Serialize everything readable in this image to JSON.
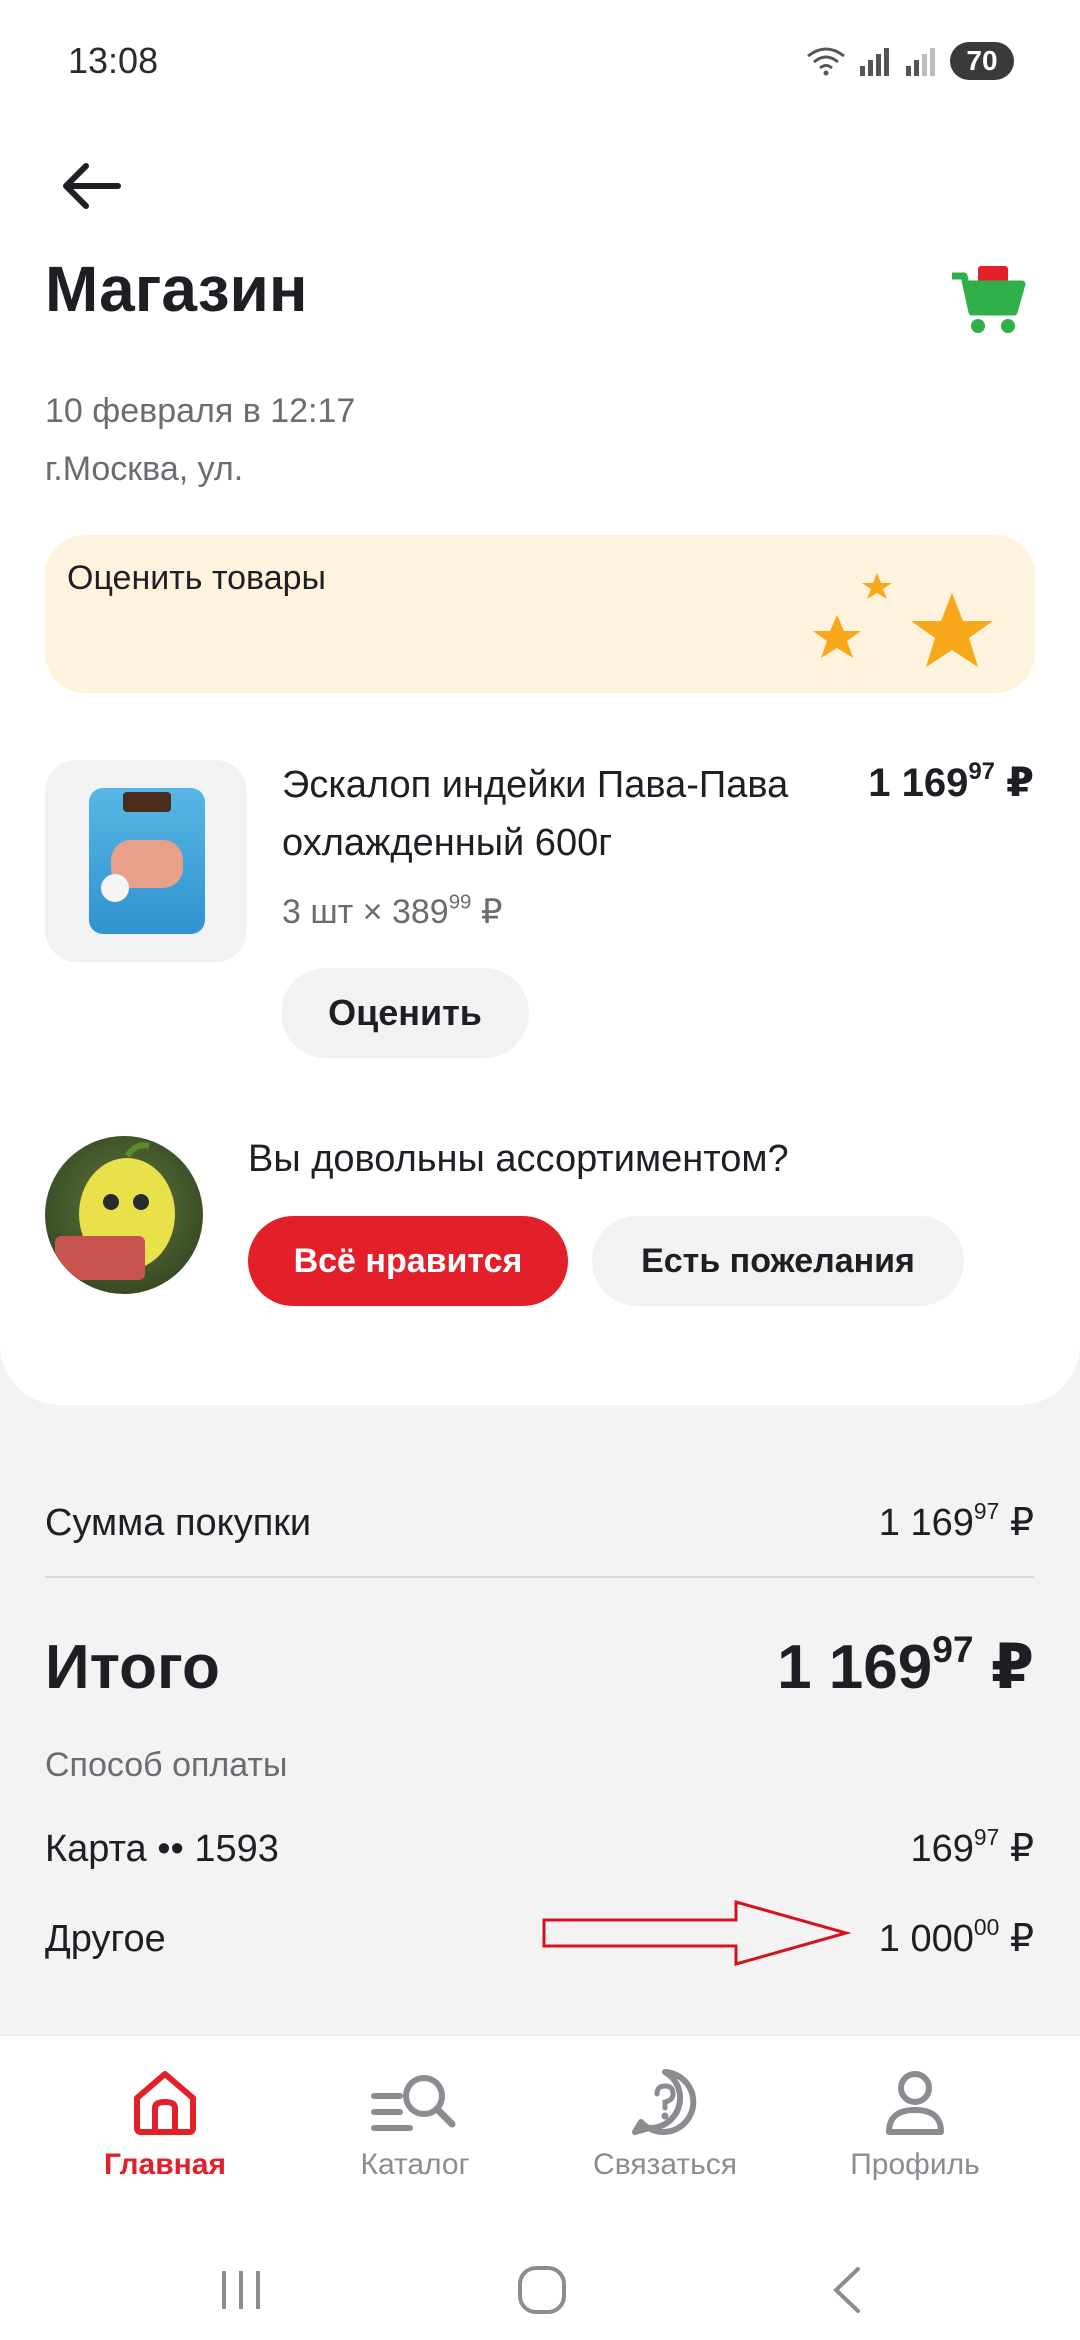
{
  "status_bar": {
    "time": "13:08",
    "battery": "70"
  },
  "header": {
    "title": "Магазин"
  },
  "order": {
    "date": "10 февраля в 12:17",
    "address": "г.Москва, ул."
  },
  "rate_banner": {
    "label": "Оценить товары"
  },
  "product": {
    "name": "Эскалоп индейки Пава-Пава охлажденный 600г",
    "price_main": "1 169",
    "price_kop": "97",
    "qty": "3 шт",
    "unit_price_main": "389",
    "unit_price_kop": "99",
    "currency": "₽",
    "rate_button": "Оценить"
  },
  "survey": {
    "question": "Вы довольны ассортиментом?",
    "like_button": "Всё нравится",
    "wish_button": "Есть пожелания"
  },
  "summary": {
    "sum_label": "Сумма покупки",
    "sum_main": "1 169",
    "sum_kop": "97",
    "total_label": "Итого",
    "total_main": "1 169",
    "total_kop": "97",
    "payment_label": "Способ оплаты",
    "card_label": "Карта •• 1593",
    "card_main": "169",
    "card_kop": "97",
    "other_label": "Другое",
    "other_main": "1 000",
    "other_kop": "00"
  },
  "nav": [
    {
      "label": "Главная",
      "icon": "home-icon",
      "active": true
    },
    {
      "label": "Каталог",
      "icon": "catalog-search-icon",
      "active": false
    },
    {
      "label": "Связаться",
      "icon": "help-chat-icon",
      "active": false
    },
    {
      "label": "Профиль",
      "icon": "profile-icon",
      "active": false
    }
  ],
  "colors": {
    "accent": "#e3202a",
    "banner": "#fff3de",
    "star": "#f7a81b",
    "cart": "#2fb04a",
    "annotation": "#d4141c"
  }
}
